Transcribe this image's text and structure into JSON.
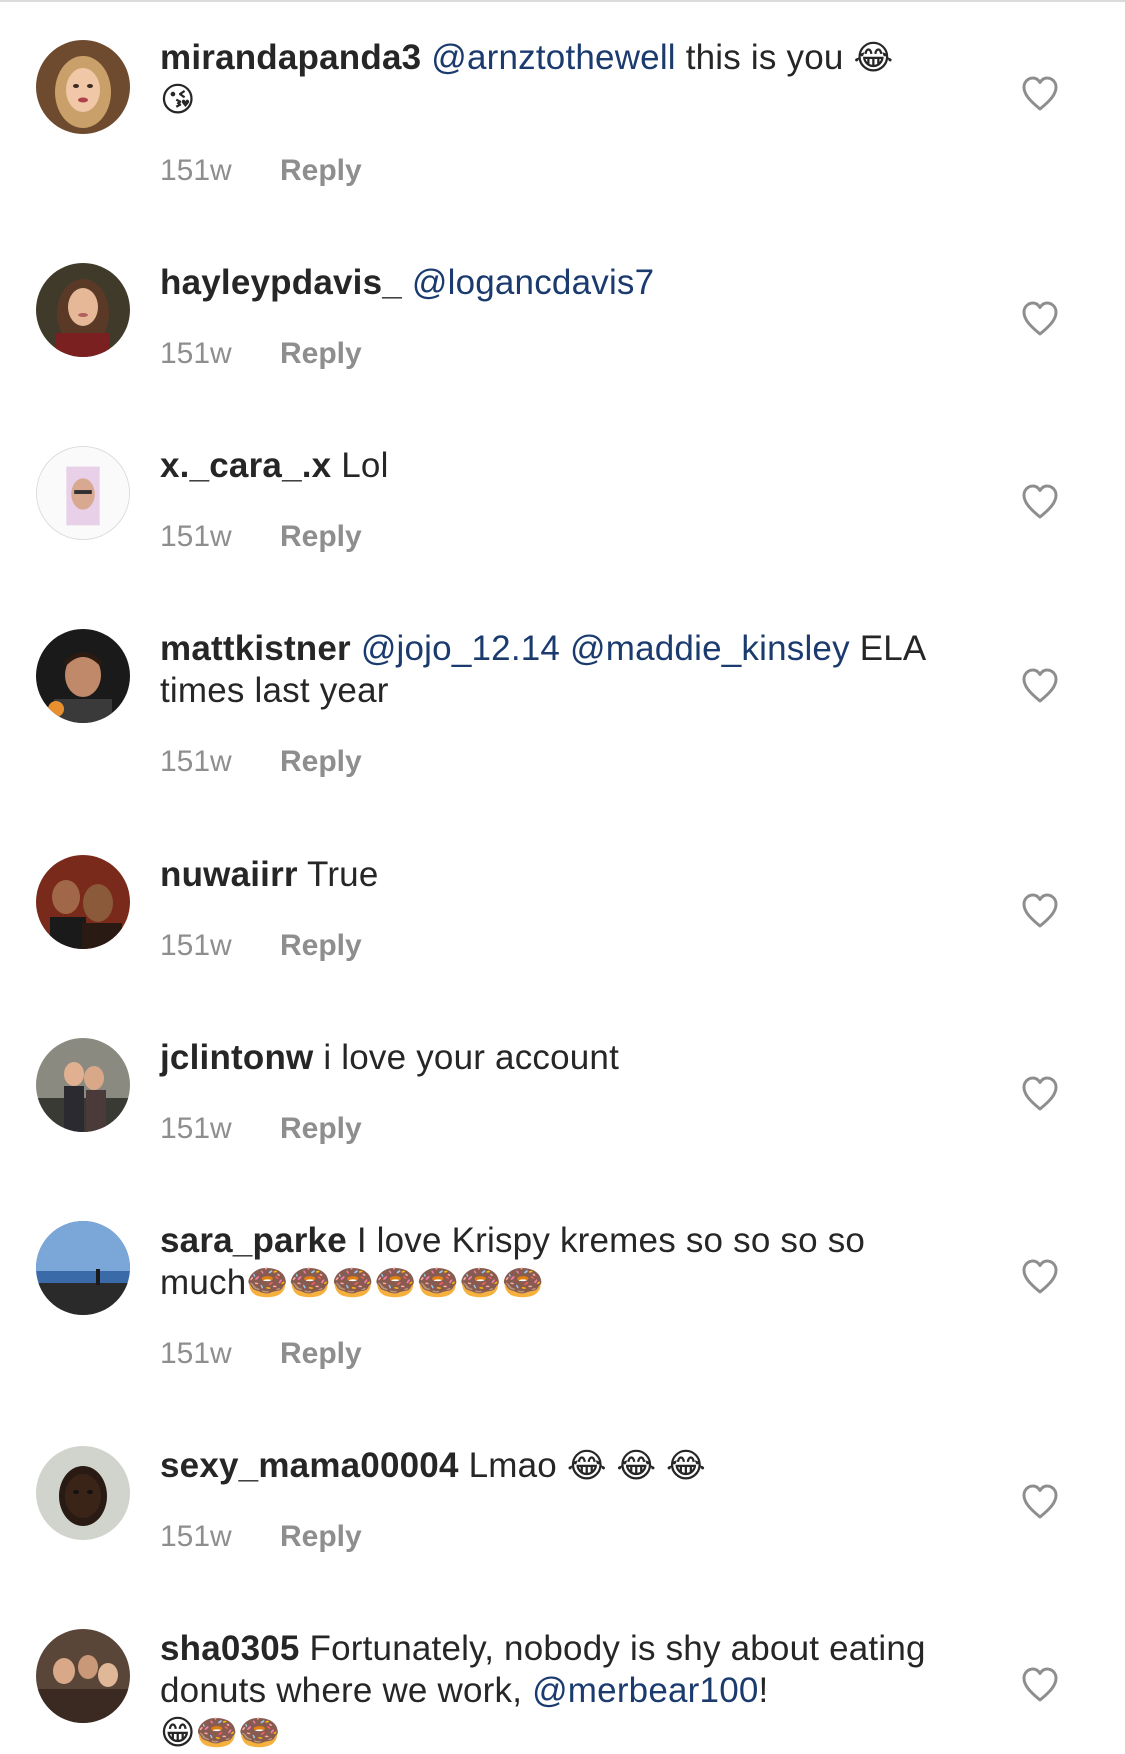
{
  "comments": [
    {
      "username": "mirandapanda3",
      "mention1": "@arnztothewell",
      "text": " this is you ",
      "emoji": "😂",
      "emoji2": "😘",
      "age": "151w",
      "reply": "Reply"
    },
    {
      "username": "hayleypdavis_",
      "mention1": "@logancdavis7",
      "age": "151w",
      "reply": "Reply"
    },
    {
      "username": "x._cara_.x",
      "text": " Lol",
      "age": "151w",
      "reply": "Reply"
    },
    {
      "username": "mattkistner",
      "mention1": "@jojo_12.14",
      "mention2": "@maddie_kinsley",
      "text": " ELA times last year",
      "age": "151w",
      "reply": "Reply"
    },
    {
      "username": "nuwaiirr",
      "text": " True",
      "age": "151w",
      "reply": "Reply"
    },
    {
      "username": "jclintonw",
      "text": " i love your account",
      "age": "151w",
      "reply": "Reply"
    },
    {
      "username": "sara_parke",
      "text": " I love Krispy kremes so so so so much",
      "emoji": "🍩🍩🍩🍩🍩🍩🍩",
      "age": "151w",
      "reply": "Reply"
    },
    {
      "username": "sexy_mama00004",
      "text": " Lmao ",
      "emoji": "😂 😂 😂",
      "age": "151w",
      "reply": "Reply"
    },
    {
      "username": "sha0305",
      "text": " Fortunately, nobody is shy about eating donuts where we work, ",
      "mention1": "@merbear100",
      "text2": "!",
      "emoji": "😁🍩🍩"
    }
  ],
  "icons": {
    "like": "heart-outline-icon",
    "avatar": "profile-photo"
  },
  "colors": {
    "username": "#262626",
    "mention": "#1b3b6f",
    "meta": "#8e8e8e"
  }
}
